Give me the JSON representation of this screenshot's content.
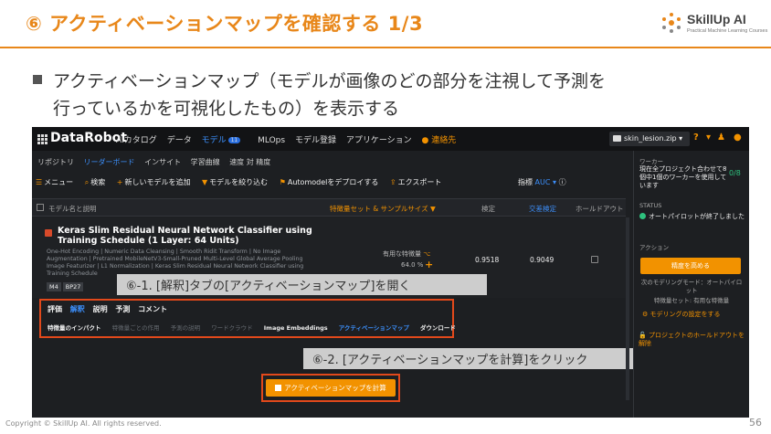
{
  "slide": {
    "title": "⑥ アクティベーションマップを確認する 1/3",
    "logo_text": "SkillUp AI",
    "logo_sub": "Practical Machine Learning Courses",
    "body_line1": "アクティベーションマップ（モデルが画像のどの部分を注視して予測を",
    "body_line2": "行っているかを可視化したもの）を表示する",
    "footer": "Copyright © SkillUp AI. All rights reserved.",
    "page_number": "56"
  },
  "app": {
    "brand": "DataRobot",
    "nav": [
      "AIカタログ",
      "データ",
      "モデル",
      "MLOps",
      "モデル登録",
      "アプリケーション"
    ],
    "nav_badge": "11",
    "notice": "連絡先",
    "project": "skin_lesion.zip",
    "subnav": [
      "リポジトリ",
      "リーダーボード",
      "インサイト",
      "学習曲線",
      "速度 対 精度"
    ],
    "toolbar": [
      "メニュー",
      "検索",
      "新しいモデルを追加",
      "モデルを絞り込む",
      "Automodelをデプロイする",
      "エクスポート"
    ],
    "metric_label": "指標",
    "metric_value": "AUC",
    "columns": [
      "モデル名と説明",
      "特徴量セット & サンプルサイズ",
      "検定",
      "交差検定",
      "ホールドアウト"
    ]
  },
  "model": {
    "title": "Keras Slim Residual Neural Network Classifier using Training Schedule (1 Layer: 64 Units)",
    "description": "One-Hot Encoding | Numeric Data Cleansing | Smooth Ridit Transform | No Image Augmentation | Pretrained MobileNetV3-Small-Pruned Multi-Level Global Average Pooling Image Featurizer | L1 Normalization | Keras Slim Residual Neural Network Classifier using Training Schedule",
    "feature_set": "有用な特徴量",
    "sample_pct": "64.0 %",
    "validation": "0.9518",
    "cross_validation": "0.9049",
    "tags": [
      "M4",
      "BP27"
    ]
  },
  "tabs": {
    "main": [
      "評価",
      "解釈",
      "説明",
      "予測",
      "コメント"
    ],
    "sub": [
      "特徴量のインパクト",
      "特徴量ごとの作用",
      "予測の説明",
      "ワードクラウド",
      "Image Embeddings",
      "アクティベーションマップ",
      "ダウンロード"
    ]
  },
  "callouts": {
    "step1": "⑥-1. [解釈]タブの[アクティベーションマップ]を開く",
    "step2": "⑥-2. [アクティベーションマップを計算]をクリック"
  },
  "compute_button": "アクティベーションマップを計算",
  "sidebar": {
    "worker_label": "ワーカー",
    "worker_text": "現在全プロジェクト合わせて8個中1個のワーカーを使用しています",
    "worker_count": "0/8",
    "status_label": "STATUS",
    "status_text": "オートパイロットが終了しました",
    "action_label": "アクション",
    "action_button": "精度を高める",
    "next_mode": "次のモデリングモード：オートパイロット",
    "feature_set": "特徴量セット: 有用な特徴量",
    "modeling_settings": "モデリングの設定をする",
    "holdout": "プロジェクトのホールドアウトを解除"
  },
  "colors": {
    "accent": "#e8871a",
    "app_orange": "#f29200",
    "link_blue": "#3c8ffb",
    "highlight_red": "#e2491b"
  }
}
